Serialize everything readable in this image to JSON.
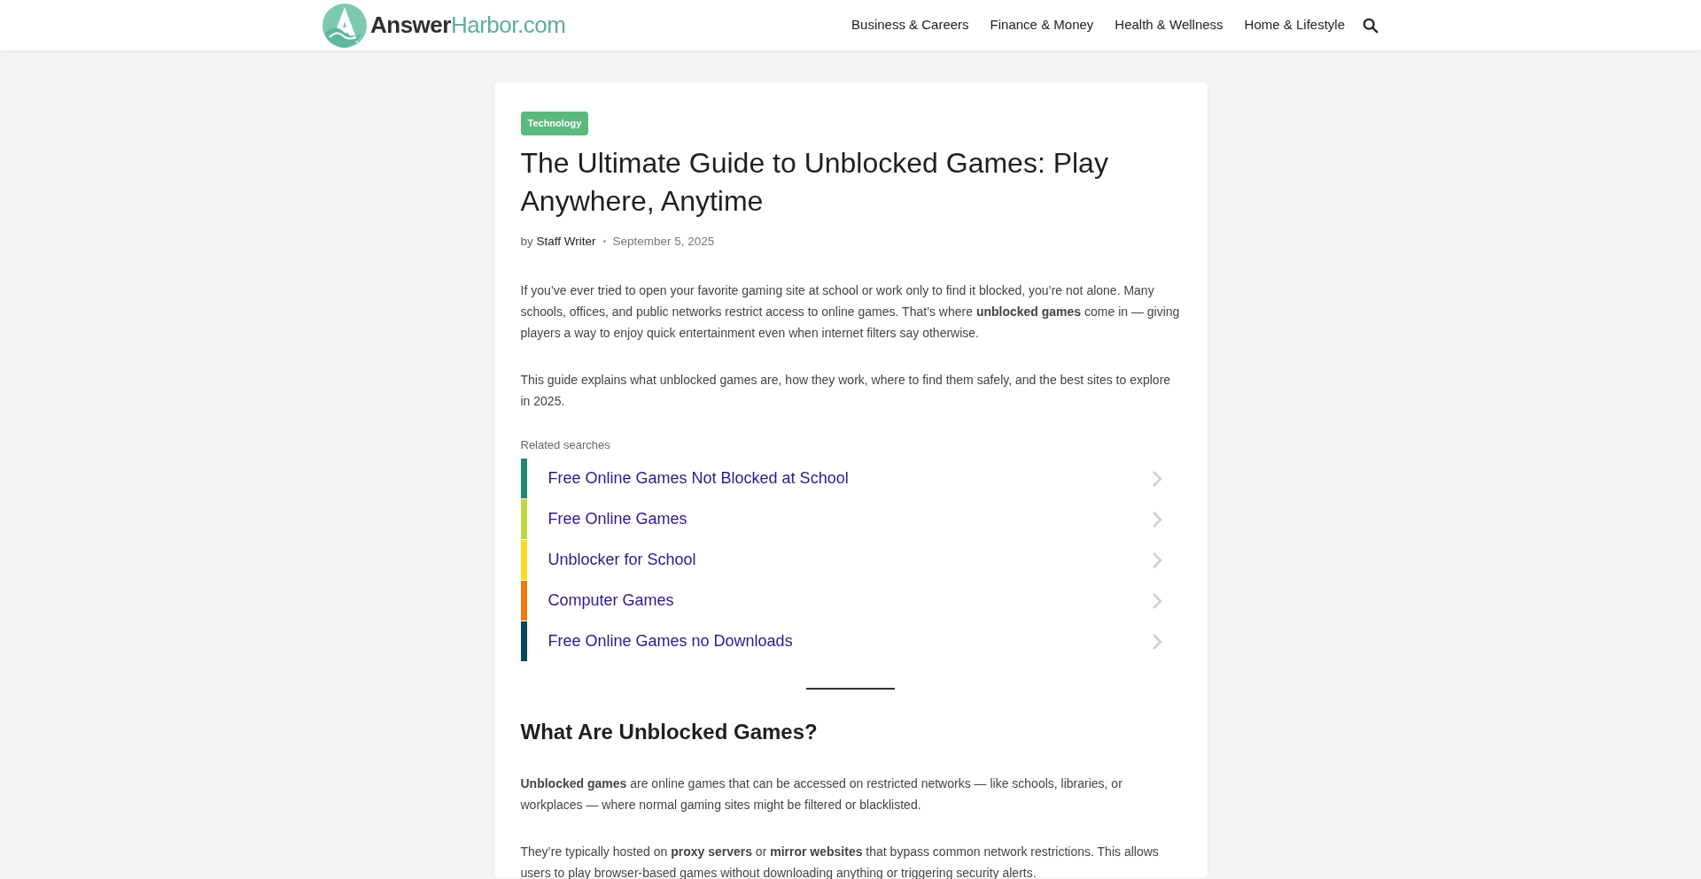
{
  "header": {
    "logo_text": "Answer",
    "logo_text_accent": "Harbor.com",
    "nav": [
      "Business & Careers",
      "Finance & Money",
      "Health & Wellness",
      "Home & Lifestyle"
    ]
  },
  "article": {
    "category": "Technology",
    "title": "The Ultimate Guide to Unblocked Games: Play Anywhere, Anytime",
    "byline_prefix": "by",
    "author": "Staff Writer",
    "date": "September 5, 2025",
    "intro": [
      "If you’ve ever tried to open your favorite gaming site at school or work only to find it blocked, you’re not alone. Many schools, offices, and public networks restrict access to online games. That’s where **unblocked games** come in — giving players a way to enjoy quick entertainment even when internet filters say otherwise.",
      "This guide explains what unblocked games are, how they work, where to find them safely, and the best sites to explore in 2025."
    ],
    "related_searches": {
      "title": "Related searches",
      "items": [
        {
          "label": "Free Online Games Not Blocked at School",
          "color": "#238773"
        },
        {
          "label": "Free Online Games",
          "color": "#bfd641"
        },
        {
          "label": "Unblocker for School",
          "color": "#fbdb1f"
        },
        {
          "label": "Computer Games",
          "color": "#f27a0d"
        },
        {
          "label": "Free Online Games no Downloads",
          "color": "#08465b"
        }
      ]
    },
    "section": {
      "heading": "What Are Unblocked Games?",
      "paragraphs": [
        "**Unblocked games** are online games that can be accessed on restricted networks — like schools, libraries, or workplaces — where normal gaming sites might be filtered or blacklisted.",
        "They’re typically hosted on **proxy servers** or **mirror websites** that bypass common network restrictions. This allows users to play browser-based games without downloading anything or triggering security alerts."
      ]
    }
  }
}
